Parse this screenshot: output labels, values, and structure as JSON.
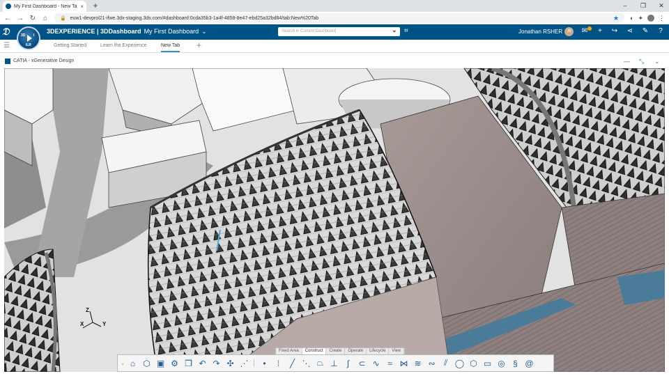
{
  "browser": {
    "tab_title": "My First Dashboard - New Tab",
    "tab_close": "×",
    "new_tab": "+",
    "url": "euw1-devprol21-ifwe.3dx-staging.3ds.com/#dashboard:0cda35b3-1a4f-4858-8e47-ebd25a32bd84/tab:New%20Tab",
    "window_controls": [
      "–",
      "❐",
      "✕"
    ]
  },
  "app": {
    "brand_bold": "3DEXPERIENCE | 3DDashboard",
    "dashboard_name": "My First Dashboard",
    "search_placeholder": "Search in Current Dashboard",
    "user_name": "Jonathan RSHER",
    "user_initials": "JR",
    "compass": {
      "top": "3D",
      "left": "V",
      "right": "I",
      "bottom": "6.R"
    }
  },
  "dashboard_tabs": [
    {
      "label": "Getting Started"
    },
    {
      "label": "Learn the Experience"
    },
    {
      "label": "New Tab"
    }
  ],
  "panel": {
    "title": "CATIA - xGenerative Design"
  },
  "viewport": {
    "axes": {
      "z": "Z",
      "x": "X",
      "y": "Y"
    }
  },
  "toolbar": {
    "tabs": [
      "Fixed Area",
      "Construct",
      "Create",
      "Operate",
      "Lifecycle",
      "View"
    ],
    "active_tab": "Construct"
  },
  "colors": {
    "app_bar": "#005386",
    "accent": "#368ec4",
    "icon_blue": "#1f5e95"
  }
}
